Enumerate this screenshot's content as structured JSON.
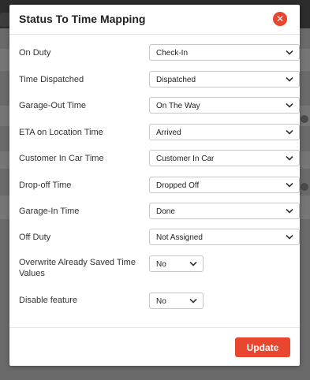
{
  "modal": {
    "title": "Status To Time Mapping",
    "close_icon": "close-circle-icon",
    "accent": "#e8462e"
  },
  "fields": [
    {
      "label": "On Duty",
      "value": "Check-In"
    },
    {
      "label": "Time Dispatched",
      "value": "Dispatched"
    },
    {
      "label": "Garage-Out Time",
      "value": "On The Way"
    },
    {
      "label": "ETA on Location Time",
      "value": "Arrived"
    },
    {
      "label": "Customer In Car Time",
      "value": "Customer In Car"
    },
    {
      "label": "Drop-off Time",
      "value": "Dropped Off"
    },
    {
      "label": "Garage-In Time",
      "value": "Done"
    },
    {
      "label": "Off Duty",
      "value": "Not Assigned"
    }
  ],
  "options": [
    {
      "label": "Overwrite Already Saved Time Values",
      "value": "No"
    },
    {
      "label": "Disable feature",
      "value": "No"
    }
  ],
  "footer": {
    "update_label": "Update"
  }
}
